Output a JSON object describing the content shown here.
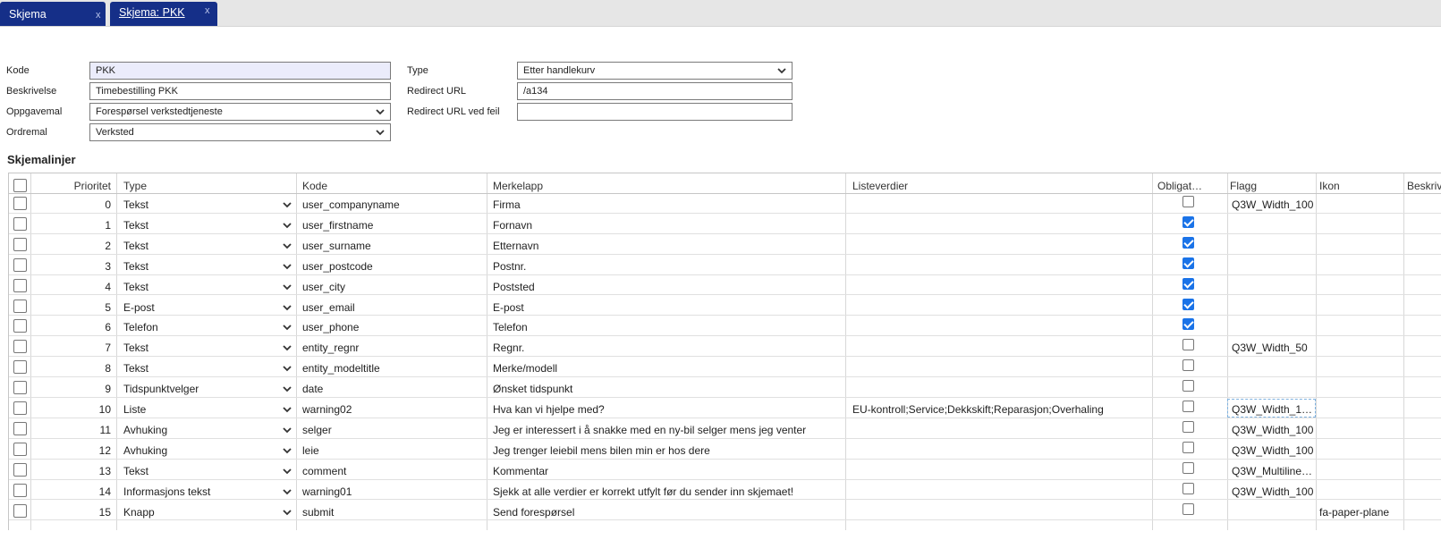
{
  "tabs": [
    {
      "label": "Skjema",
      "close": "x"
    },
    {
      "label": "Skjema: PKK",
      "close": "x"
    }
  ],
  "form": {
    "kode_label": "Kode",
    "kode_value": "PKK",
    "beskrivelse_label": "Beskrivelse",
    "beskrivelse_value": "Timebestilling PKK",
    "oppgavemal_label": "Oppgavemal",
    "oppgavemal_value": "Forespørsel verkstedtjeneste",
    "ordremal_label": "Ordremal",
    "ordremal_value": "Verksted",
    "type_label": "Type",
    "type_value": "Etter handlekurv",
    "redirect_label": "Redirect URL",
    "redirect_value": "/a134",
    "redirect_err_label": "Redirect URL ved feil",
    "redirect_err_value": ""
  },
  "section_title": "Skjemalinjer",
  "columns": {
    "prioritet": "Prioritet",
    "type": "Type",
    "kode": "Kode",
    "merkelapp": "Merkelapp",
    "listeverdier": "Listeverdier",
    "obligat": "Obligat…",
    "flagg": "Flagg",
    "ikon": "Ikon",
    "beskrivelse": "Beskrivelse"
  },
  "rows": [
    {
      "prioritet": "0",
      "type": "Tekst",
      "kode": "user_companyname",
      "merkelapp": "Firma",
      "listeverdier": "",
      "obligatorisk": false,
      "flagg": "Q3W_Width_100",
      "ikon": ""
    },
    {
      "prioritet": "1",
      "type": "Tekst",
      "kode": "user_firstname",
      "merkelapp": "Fornavn",
      "listeverdier": "",
      "obligatorisk": true,
      "flagg": "",
      "ikon": ""
    },
    {
      "prioritet": "2",
      "type": "Tekst",
      "kode": "user_surname",
      "merkelapp": "Etternavn",
      "listeverdier": "",
      "obligatorisk": true,
      "flagg": "",
      "ikon": ""
    },
    {
      "prioritet": "3",
      "type": "Tekst",
      "kode": "user_postcode",
      "merkelapp": "Postnr.",
      "listeverdier": "",
      "obligatorisk": true,
      "flagg": "",
      "ikon": ""
    },
    {
      "prioritet": "4",
      "type": "Tekst",
      "kode": "user_city",
      "merkelapp": "Poststed",
      "listeverdier": "",
      "obligatorisk": true,
      "flagg": "",
      "ikon": ""
    },
    {
      "prioritet": "5",
      "type": "E-post",
      "kode": "user_email",
      "merkelapp": "E-post",
      "listeverdier": "",
      "obligatorisk": true,
      "flagg": "",
      "ikon": ""
    },
    {
      "prioritet": "6",
      "type": "Telefon",
      "kode": "user_phone",
      "merkelapp": "Telefon",
      "listeverdier": "",
      "obligatorisk": true,
      "flagg": "",
      "ikon": ""
    },
    {
      "prioritet": "7",
      "type": "Tekst",
      "kode": "entity_regnr",
      "merkelapp": "Regnr.",
      "listeverdier": "",
      "obligatorisk": false,
      "flagg": "Q3W_Width_50",
      "ikon": ""
    },
    {
      "prioritet": "8",
      "type": "Tekst",
      "kode": "entity_modeltitle",
      "merkelapp": "Merke/modell",
      "listeverdier": "",
      "obligatorisk": false,
      "flagg": "",
      "ikon": ""
    },
    {
      "prioritet": "9",
      "type": "Tidspunktvelger",
      "kode": "date",
      "merkelapp": "Ønsket tidspunkt",
      "listeverdier": "",
      "obligatorisk": false,
      "flagg": "",
      "ikon": ""
    },
    {
      "prioritet": "10",
      "type": "Liste",
      "kode": "warning02",
      "merkelapp": "Hva kan vi hjelpe med?",
      "listeverdier": "EU-kontroll;Service;Dekkskift;Reparasjon;Overhaling",
      "obligatorisk": false,
      "flagg": "Q3W_Width_1…",
      "ikon": ""
    },
    {
      "prioritet": "11",
      "type": "Avhuking",
      "kode": "selger",
      "merkelapp": "Jeg er interessert i å snakke med en ny-bil selger mens jeg venter",
      "listeverdier": "",
      "obligatorisk": false,
      "flagg": "Q3W_Width_100",
      "ikon": ""
    },
    {
      "prioritet": "12",
      "type": "Avhuking",
      "kode": "leie",
      "merkelapp": "Jeg trenger leiebil mens bilen min er hos dere",
      "listeverdier": "",
      "obligatorisk": false,
      "flagg": "Q3W_Width_100",
      "ikon": ""
    },
    {
      "prioritet": "13",
      "type": "Tekst",
      "kode": "comment",
      "merkelapp": "Kommentar",
      "listeverdier": "",
      "obligatorisk": false,
      "flagg": "Q3W_Multiline,…",
      "ikon": ""
    },
    {
      "prioritet": "14",
      "type": "Informasjons tekst",
      "kode": "warning01",
      "merkelapp": "Sjekk at alle verdier er korrekt utfylt før du sender inn skjemaet!",
      "listeverdier": "",
      "obligatorisk": false,
      "flagg": "Q3W_Width_100",
      "ikon": ""
    },
    {
      "prioritet": "15",
      "type": "Knapp",
      "kode": "submit",
      "merkelapp": "Send forespørsel",
      "listeverdier": "",
      "obligatorisk": false,
      "flagg": "",
      "ikon": "fa-paper-plane"
    }
  ],
  "colors": {
    "tab_bg": "#152f88",
    "check_blue": "#1a73e8",
    "highlight_field": "#ebecfb"
  }
}
